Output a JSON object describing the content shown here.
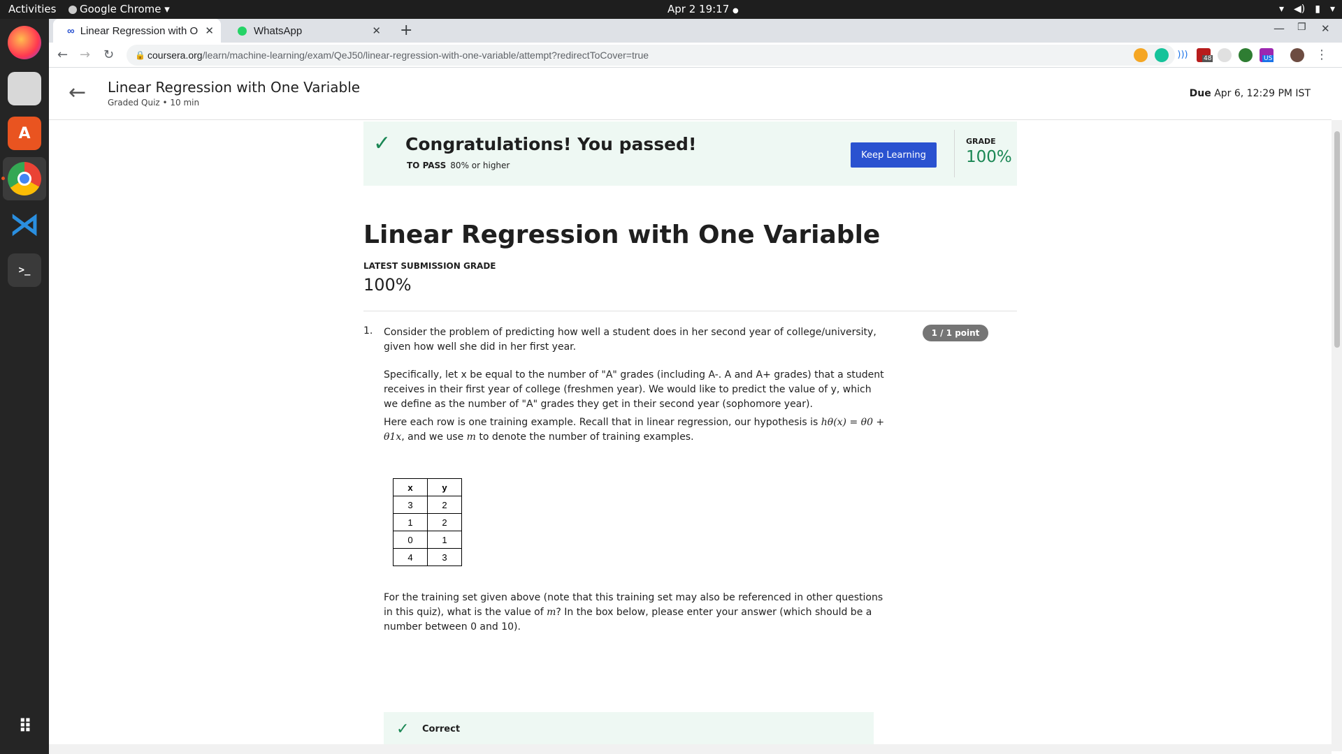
{
  "system": {
    "activities": "Activities",
    "app_name": "Google Chrome",
    "clock": "Apr 2  19:17"
  },
  "browser": {
    "tabs": [
      {
        "title": "Linear Regression with O",
        "active": true
      },
      {
        "title": "WhatsApp",
        "active": false
      }
    ],
    "url_host": "coursera.org",
    "url_path": "/learn/machine-learning/exam/QeJ50/linear-regression-with-one-variable/attempt?redirectToCover=true",
    "extension_badges": [
      "48",
      "US"
    ]
  },
  "header": {
    "title": "Linear Regression with One Variable",
    "subtitle": "Graded Quiz • 10 min",
    "due_label": "Due",
    "due_value": "Apr 6, 12:29 PM IST"
  },
  "banner": {
    "title": "Congratulations! You passed!",
    "to_pass_label": "TO PASS",
    "to_pass_value": "80% or higher",
    "button": "Keep Learning",
    "grade_label": "GRADE",
    "grade_value": "100%"
  },
  "main": {
    "title": "Linear Regression with One Variable",
    "latest_label": "LATEST SUBMISSION GRADE",
    "latest_value": "100%"
  },
  "question": {
    "number": "1.",
    "points": "1 / 1 point",
    "p1": "Consider the problem of predicting how well a student does in her second year of college/university, given how well she did in her first year.",
    "p2": "Specifically, let x be equal to the number of \"A\" grades (including A-. A and A+ grades) that a student receives in their first year of college (freshmen year). We would like to predict the value of y, which we define as the number of \"A\" grades they get in their second year (sophomore year).",
    "p3_a": "Here each row is one training example. Recall that in linear regression, our hypothesis is ",
    "p3_math": "hθ(x) = θ0 + θ1x",
    "p3_b": ", and we use ",
    "p3_m": "m",
    "p3_c": " to denote the number of training examples.",
    "table": {
      "headers": [
        "x",
        "y"
      ],
      "rows": [
        [
          "3",
          "2"
        ],
        [
          "1",
          "2"
        ],
        [
          "0",
          "1"
        ],
        [
          "4",
          "3"
        ]
      ]
    },
    "p4_a": "For the training set given above (note that this training set may also be referenced in other questions in this quiz), what is the value of ",
    "p4_m": "m",
    "p4_b": "? In the box below, please enter your answer (which should be a number between 0 and 10).",
    "feedback": "Correct"
  },
  "colors": {
    "accent_blue": "#2a52d0",
    "success_green": "#1a8754",
    "banner_bg": "#eef8f3"
  }
}
